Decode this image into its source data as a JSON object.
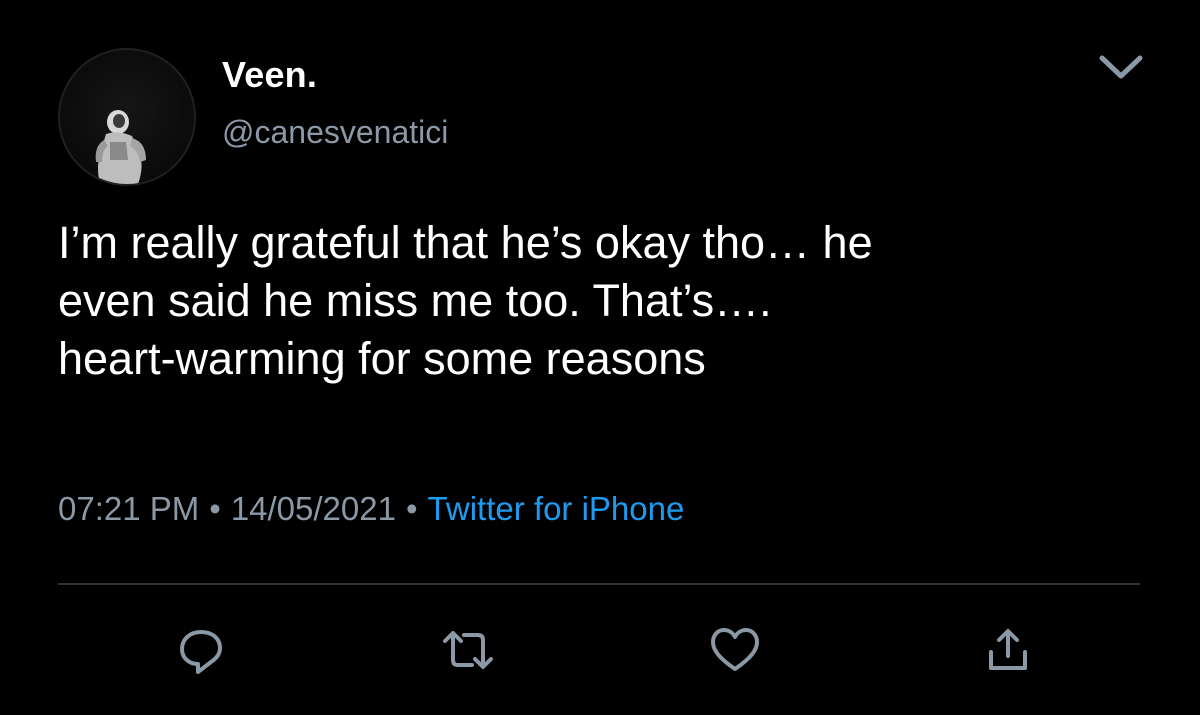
{
  "user": {
    "display_name": "Veen.",
    "handle": "@canesvenatici"
  },
  "tweet": {
    "text": "I’m really grateful that he’s okay tho… he\neven said he miss me too. That’s….\nheart-warming for some reasons",
    "time": "07:21 PM",
    "date": "14/05/2021",
    "source": "Twitter for iPhone",
    "separator": "•"
  },
  "icons": {
    "menu": "chevron-down-icon",
    "reply": "reply-icon",
    "retweet": "retweet-icon",
    "like": "heart-icon",
    "share": "share-icon"
  },
  "colors": {
    "background": "#000000",
    "text": "#ffffff",
    "secondary": "#8b98a5",
    "link": "#1d9bf0",
    "divider": "#2f3336"
  }
}
